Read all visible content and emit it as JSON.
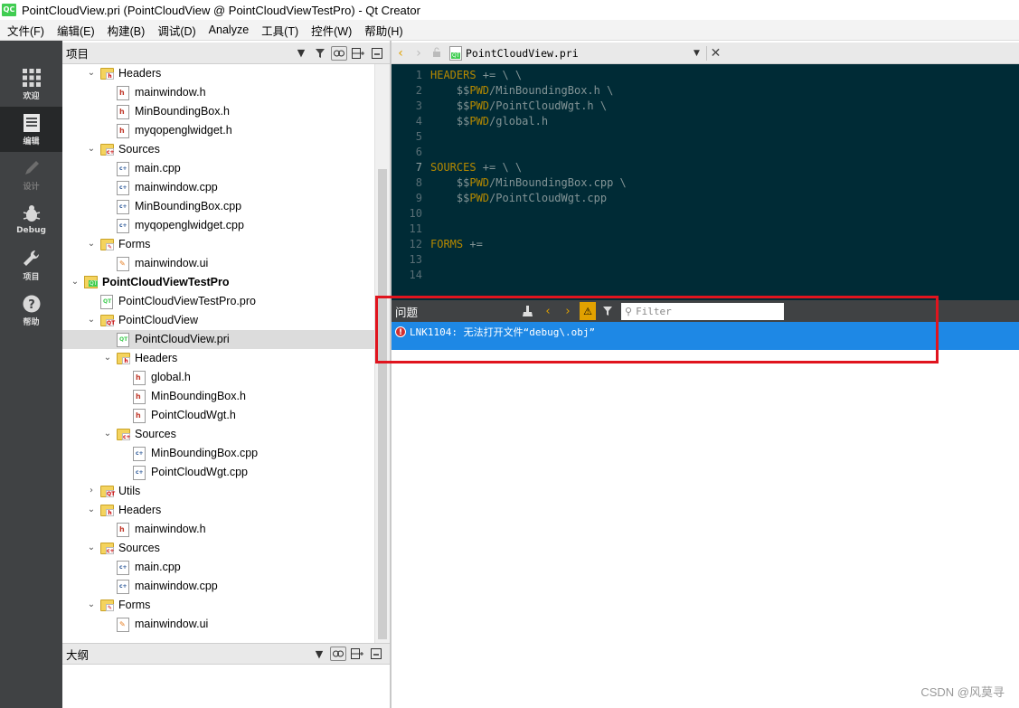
{
  "window": {
    "title": "PointCloudView.pri (PointCloudView @ PointCloudViewTestPro) - Qt Creator",
    "logo": "QC"
  },
  "menu": [
    "文件(F)",
    "编辑(E)",
    "构建(B)",
    "调试(D)",
    "Analyze",
    "工具(T)",
    "控件(W)",
    "帮助(H)"
  ],
  "modes": [
    {
      "label": "欢迎",
      "icon": "grid-icon"
    },
    {
      "label": "编辑",
      "icon": "edit-icon"
    },
    {
      "label": "设计",
      "icon": "pencil-icon"
    },
    {
      "label": "Debug",
      "icon": "bug-icon"
    },
    {
      "label": "项目",
      "icon": "wrench-icon"
    },
    {
      "label": "帮助",
      "icon": "help-icon"
    }
  ],
  "project_panel": {
    "title": "项目"
  },
  "tree": [
    {
      "label": "Headers",
      "type": "folder-h",
      "expanded": true
    },
    {
      "label": "mainwindow.h",
      "type": "h"
    },
    {
      "label": "MinBoundingBox.h",
      "type": "h"
    },
    {
      "label": "myqopenglwidget.h",
      "type": "h"
    },
    {
      "label": "Sources",
      "type": "folder-cpp",
      "expanded": true
    },
    {
      "label": "main.cpp",
      "type": "cpp"
    },
    {
      "label": "mainwindow.cpp",
      "type": "cpp"
    },
    {
      "label": "MinBoundingBox.cpp",
      "type": "cpp"
    },
    {
      "label": "myqopenglwidget.cpp",
      "type": "cpp"
    },
    {
      "label": "Forms",
      "type": "folder-ui",
      "expanded": true
    },
    {
      "label": "mainwindow.ui",
      "type": "ui"
    },
    {
      "label": "PointCloudViewTestPro",
      "type": "project",
      "expanded": true
    },
    {
      "label": "PointCloudViewTestPro.pro",
      "type": "pro"
    },
    {
      "label": "PointCloudView",
      "type": "folder-qt",
      "expanded": true
    },
    {
      "label": "PointCloudView.pri",
      "type": "pro",
      "selected": true
    },
    {
      "label": "Headers",
      "type": "folder-h",
      "expanded": true
    },
    {
      "label": "global.h",
      "type": "h"
    },
    {
      "label": "MinBoundingBox.h",
      "type": "h"
    },
    {
      "label": "PointCloudWgt.h",
      "type": "h"
    },
    {
      "label": "Sources",
      "type": "folder-cpp",
      "expanded": true
    },
    {
      "label": "MinBoundingBox.cpp",
      "type": "cpp"
    },
    {
      "label": "PointCloudWgt.cpp",
      "type": "cpp"
    },
    {
      "label": "Utils",
      "type": "folder-qt",
      "expanded": false
    },
    {
      "label": "Headers",
      "type": "folder-h",
      "expanded": true
    },
    {
      "label": "mainwindow.h",
      "type": "h"
    },
    {
      "label": "Sources",
      "type": "folder-cpp",
      "expanded": true
    },
    {
      "label": "main.cpp",
      "type": "cpp"
    },
    {
      "label": "mainwindow.cpp",
      "type": "cpp"
    },
    {
      "label": "Forms",
      "type": "folder-ui",
      "expanded": true
    },
    {
      "label": "mainwindow.ui",
      "type": "ui"
    }
  ],
  "outline_panel": {
    "title": "大纲"
  },
  "editor": {
    "file_name": "PointCloudView.pri",
    "lines": [
      {
        "n": "1",
        "tokens": [
          [
            "kw",
            "HEADERS"
          ],
          [
            "op",
            " += \\ \\"
          ]
        ]
      },
      {
        "n": "2",
        "tokens": [
          [
            "op",
            "    $$"
          ],
          [
            "kw",
            "PWD"
          ],
          [
            "op",
            "/MinBoundingBox.h \\"
          ]
        ]
      },
      {
        "n": "3",
        "tokens": [
          [
            "op",
            "    $$"
          ],
          [
            "kw",
            "PWD"
          ],
          [
            "op",
            "/PointCloudWgt.h \\"
          ]
        ]
      },
      {
        "n": "4",
        "tokens": [
          [
            "op",
            "    $$"
          ],
          [
            "kw",
            "PWD"
          ],
          [
            "op",
            "/global.h"
          ]
        ]
      },
      {
        "n": "5",
        "tokens": []
      },
      {
        "n": "6",
        "tokens": []
      },
      {
        "n": "7",
        "tokens": [
          [
            "kw",
            "SOURCES"
          ],
          [
            "op",
            " += \\ \\"
          ]
        ]
      },
      {
        "n": "8",
        "tokens": [
          [
            "op",
            "    $$"
          ],
          [
            "kw",
            "PWD"
          ],
          [
            "op",
            "/MinBoundingBox.cpp \\"
          ]
        ]
      },
      {
        "n": "9",
        "tokens": [
          [
            "op",
            "    $$"
          ],
          [
            "kw",
            "PWD"
          ],
          [
            "op",
            "/PointCloudWgt.cpp"
          ]
        ]
      },
      {
        "n": "10",
        "tokens": []
      },
      {
        "n": "11",
        "tokens": []
      },
      {
        "n": "12",
        "tokens": [
          [
            "kw",
            "FORMS"
          ],
          [
            "op",
            " +="
          ]
        ]
      },
      {
        "n": "13",
        "tokens": []
      },
      {
        "n": "14",
        "tokens": []
      }
    ],
    "current_line": "7"
  },
  "issues": {
    "title": "问题",
    "filter_placeholder": "Filter",
    "items": [
      {
        "severity": "error",
        "message": "LNK1104: 无法打开文件“debug\\.obj”"
      }
    ]
  },
  "watermark": "CSDN @风莫寻"
}
